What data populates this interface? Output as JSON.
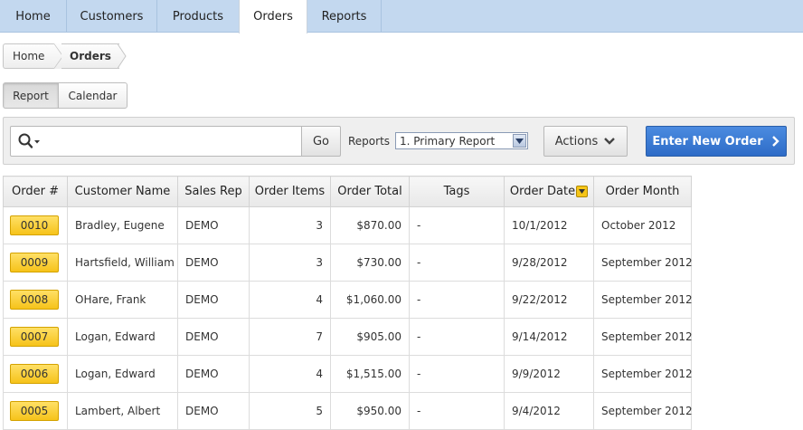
{
  "tabs": [
    {
      "label": "Home",
      "active": false
    },
    {
      "label": "Customers",
      "active": false
    },
    {
      "label": "Products",
      "active": false
    },
    {
      "label": "Orders",
      "active": true
    },
    {
      "label": "Reports",
      "active": false
    }
  ],
  "breadcrumb": {
    "home": "Home",
    "current": "Orders"
  },
  "view_toggle": {
    "report": "Report",
    "calendar": "Calendar",
    "selected": "Report"
  },
  "search": {
    "value": "",
    "go_label": "Go",
    "search_icon": "magnifier-dropdown-icon"
  },
  "reports": {
    "label": "Reports",
    "selected": "1. Primary Report"
  },
  "actions_label": "Actions",
  "enter_new_order_label": "Enter New Order",
  "table": {
    "columns": [
      "Order #",
      "Customer Name",
      "Sales Rep",
      "Order Items",
      "Order Total",
      "Tags",
      "Order Date",
      "Order Month"
    ],
    "sorted_column": "Order Date",
    "rows": [
      {
        "order": "0010",
        "customer": "Bradley, Eugene",
        "rep": "DEMO",
        "items": "3",
        "total": "$870.00",
        "tags": "-",
        "date": "10/1/2012",
        "month": "October 2012"
      },
      {
        "order": "0009",
        "customer": "Hartsfield, William",
        "rep": "DEMO",
        "items": "3",
        "total": "$730.00",
        "tags": "-",
        "date": "9/28/2012",
        "month": "September 2012"
      },
      {
        "order": "0008",
        "customer": "OHare, Frank",
        "rep": "DEMO",
        "items": "4",
        "total": "$1,060.00",
        "tags": "-",
        "date": "9/22/2012",
        "month": "September 2012"
      },
      {
        "order": "0007",
        "customer": "Logan, Edward",
        "rep": "DEMO",
        "items": "7",
        "total": "$905.00",
        "tags": "-",
        "date": "9/14/2012",
        "month": "September 2012"
      },
      {
        "order": "0006",
        "customer": "Logan, Edward",
        "rep": "DEMO",
        "items": "4",
        "total": "$1,515.00",
        "tags": "-",
        "date": "9/9/2012",
        "month": "September 2012"
      },
      {
        "order": "0005",
        "customer": "Lambert, Albert",
        "rep": "DEMO",
        "items": "5",
        "total": "$950.00",
        "tags": "-",
        "date": "9/4/2012",
        "month": "September 2012"
      }
    ]
  },
  "colors": {
    "tab_bar": "#c3d8ef",
    "primary_button": "#2e6cc7",
    "order_badge": "#f6c31a"
  }
}
